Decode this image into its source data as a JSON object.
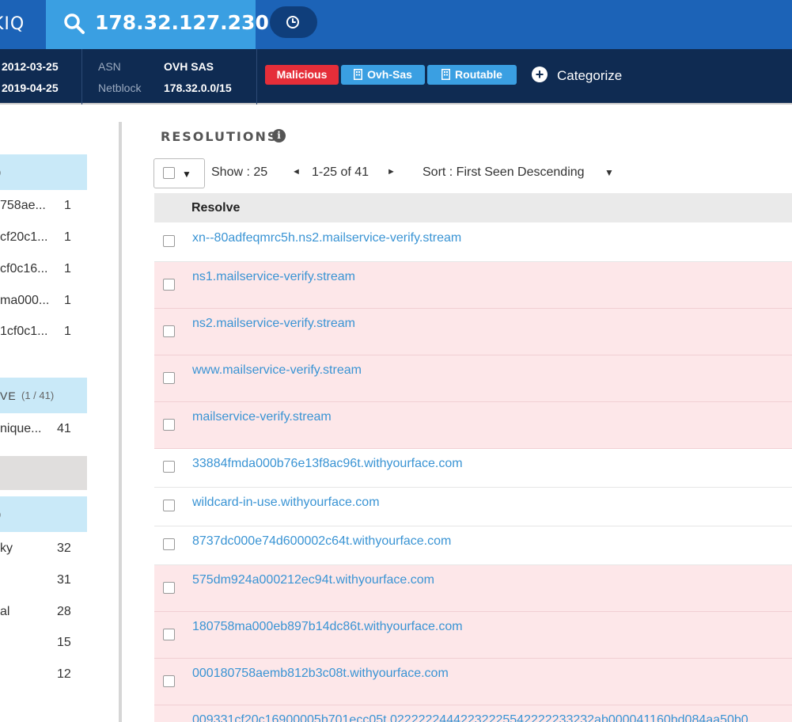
{
  "header": {
    "logo_text": "KIQ",
    "search_value": "178.32.127.230"
  },
  "subheader": {
    "first_seen": "2012-03-25",
    "last_seen": "2019-04-25",
    "asn_label": "ASN",
    "asn_value": "OVH SAS",
    "netblock_label": "Netblock",
    "netblock_value": "178.32.0.0/15",
    "tags": [
      "Malicious",
      "Ovh-Sas",
      "Routable"
    ],
    "categorize_label": "Categorize"
  },
  "left_panel": {
    "header1": ")",
    "group1": [
      {
        "name": "758ae...",
        "count": "1"
      },
      {
        "name": "cf20c1...",
        "count": "1"
      },
      {
        "name": "cf0c16...",
        "count": "1"
      },
      {
        "name": "ma000...",
        "count": "1"
      },
      {
        "name": "1cf0c1...",
        "count": "1"
      }
    ],
    "header2": "VE",
    "header2_count": "(1 / 41)",
    "group2": [
      {
        "name": "nique...",
        "count": "41"
      }
    ],
    "header3": ")",
    "group3": [
      {
        "name": "ky",
        "count": "32"
      },
      {
        "name": "",
        "count": "31"
      },
      {
        "name": "al",
        "count": "28"
      },
      {
        "name": "",
        "count": "15"
      },
      {
        "name": "",
        "count": "12"
      }
    ]
  },
  "main": {
    "section_title": "RESOLUTIONS",
    "toolbar": {
      "show_label": "Show : 25",
      "prev_arrow": "◄",
      "range_label": "1-25 of 41",
      "next_arrow": "►",
      "sort_label": "Sort : First Seen Descending",
      "sort_caret": "▼",
      "select_caret": "▼"
    },
    "table": {
      "column_resolve": "Resolve",
      "rows": [
        {
          "resolve": "xn--80adfeqmrc5h.ns2.mailservice-verify.stream",
          "flag": "clean"
        },
        {
          "resolve": "ns1.mailservice-verify.stream",
          "flag": "malicious"
        },
        {
          "resolve": "ns2.mailservice-verify.stream",
          "flag": "malicious"
        },
        {
          "resolve": "www.mailservice-verify.stream",
          "flag": "malicious"
        },
        {
          "resolve": "mailservice-verify.stream",
          "flag": "malicious"
        },
        {
          "resolve": "33884fmda000b76e13f8ac96t.withyourface.com",
          "flag": "clean"
        },
        {
          "resolve": "wildcard-in-use.withyourface.com",
          "flag": "clean"
        },
        {
          "resolve": "8737dc000e74d600002c64t.withyourface.com",
          "flag": "clean"
        },
        {
          "resolve": "575dm924a000212ec94t.withyourface.com",
          "flag": "malicious"
        },
        {
          "resolve": "180758ma000eb897b14dc86t.withyourface.com",
          "flag": "malicious"
        },
        {
          "resolve": "000180758aemb812b3c08t.withyourface.com",
          "flag": "malicious"
        },
        {
          "resolve": "009331cf20c16900005b701ecc05t.02222224442232225542222233232ab000041160bd084aa50b0",
          "flag": "malicious"
        }
      ]
    }
  }
}
